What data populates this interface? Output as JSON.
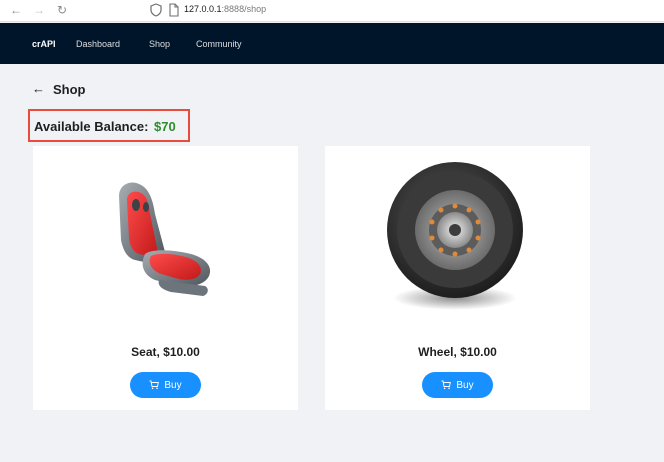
{
  "browser": {
    "url_host": "127.0.0.1",
    "url_rest": ":8888/shop"
  },
  "nav": {
    "brand": "crAPI",
    "links": [
      "Dashboard",
      "Shop",
      "Community"
    ]
  },
  "page": {
    "title": "Shop"
  },
  "balance": {
    "label": "Available Balance:",
    "value": "$70",
    "value_color": "#2e8b2e",
    "highlight_color": "#e74c3c"
  },
  "products": [
    {
      "name": "Seat, $10.00",
      "buy_label": "Buy",
      "icon": "car-seat-image"
    },
    {
      "name": "Wheel, $10.00",
      "buy_label": "Buy",
      "icon": "wheel-image"
    }
  ],
  "colors": {
    "nav_bg": "#001529",
    "accent": "#1890ff",
    "page_bg": "#f0f2f5"
  }
}
